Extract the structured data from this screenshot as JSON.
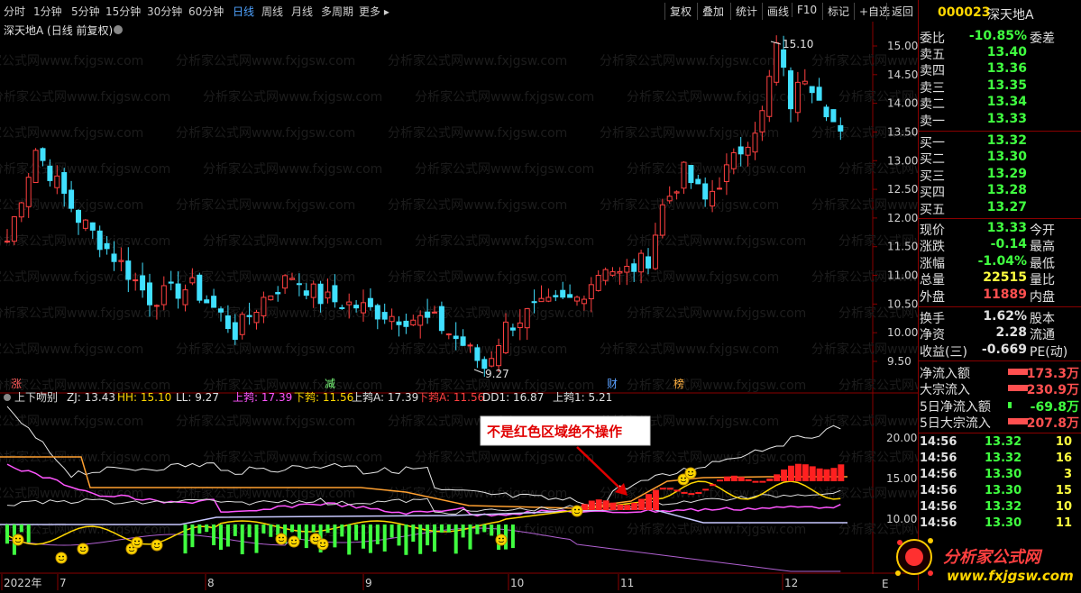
{
  "toolbar": {
    "periods": [
      "分时",
      "1分钟",
      "5分钟",
      "15分钟",
      "30分钟",
      "60分钟",
      "日线",
      "周线",
      "月线",
      "多周期",
      "更多 ▸"
    ],
    "active": "日线",
    "actions": [
      "复权",
      "叠加",
      "统计",
      "画线",
      "F10",
      "标记",
      "+自选",
      "返回"
    ]
  },
  "chart": {
    "title": "深天地A (日线 前复权)",
    "high_label": "15.10",
    "low_label": "9.27",
    "price_axis": [
      "15.00",
      "14.50",
      "14.00",
      "13.50",
      "13.00",
      "12.50",
      "12.00",
      "11.50",
      "11.00",
      "10.50",
      "10.00",
      "9.50"
    ],
    "markers": [
      {
        "text": "涨",
        "color": "#ff5a5a"
      },
      {
        "text": "减",
        "color": "#7cff7c"
      },
      {
        "text": "财",
        "color": "#5aa0ff"
      },
      {
        "text": "榜",
        "color": "#ffb040"
      }
    ],
    "watermark": "分析家公式网www.fxjgsw.com"
  },
  "indicator": {
    "name": "上下吻别",
    "params": [
      {
        "label": "ZJ: 13.43",
        "color": "#e0e0e0"
      },
      {
        "label": "HH: 15.10",
        "color": "#ffd700"
      },
      {
        "label": "LL: 9.27",
        "color": "#e0e0e0"
      },
      {
        "label": "上鹁: 17.39",
        "color": "#ff55ff"
      },
      {
        "label": "下鹁: 11.56",
        "color": "#ffd700"
      },
      {
        "label": "上鹁A: 17.39",
        "color": "#e0e0e0"
      },
      {
        "label": "下鹁A: 11.56",
        "color": "#ff4040"
      },
      {
        "label": "DD1: 16.87",
        "color": "#e0e0e0"
      },
      {
        "label": "上鹁1: 5.21",
        "color": "#e0e0e0"
      }
    ],
    "annotation": "不是红色区域绝不操作",
    "axis": [
      "20.00",
      "15.00",
      "10.00"
    ]
  },
  "date_axis": [
    "2022年",
    "7",
    "8",
    "9",
    "10",
    "11",
    "12"
  ],
  "stock": {
    "code": "000023",
    "name": "深天地A"
  },
  "quote": {
    "weibi": {
      "label": "委比",
      "value": "-10.85%",
      "extra": "委差"
    },
    "asks": [
      {
        "label": "卖五",
        "price": "13.40"
      },
      {
        "label": "卖四",
        "price": "13.36"
      },
      {
        "label": "卖三",
        "price": "13.35"
      },
      {
        "label": "卖二",
        "price": "13.34"
      },
      {
        "label": "卖一",
        "price": "13.33"
      }
    ],
    "bids": [
      {
        "label": "买一",
        "price": "13.32"
      },
      {
        "label": "买二",
        "price": "13.30"
      },
      {
        "label": "买三",
        "price": "13.29"
      },
      {
        "label": "买四",
        "price": "13.28"
      },
      {
        "label": "买五",
        "price": "13.27"
      }
    ],
    "stats": [
      {
        "l": "现价",
        "v": "13.33",
        "c": "#40ff40",
        "r": "今开"
      },
      {
        "l": "涨跌",
        "v": "-0.14",
        "c": "#40ff40",
        "r": "最高"
      },
      {
        "l": "涨幅",
        "v": "-1.04%",
        "c": "#40ff40",
        "r": "最低"
      },
      {
        "l": "总量",
        "v": "22515",
        "c": "#ffff40",
        "r": "量比"
      },
      {
        "l": "外盘",
        "v": "11889",
        "c": "#ff5050",
        "r": "内盘"
      }
    ],
    "stats2": [
      {
        "l": "换手",
        "v": "1.62%",
        "c": "#e0e0e0",
        "r": "股本"
      },
      {
        "l": "净资",
        "v": "2.28",
        "c": "#e0e0e0",
        "r": "流通"
      },
      {
        "l": "收益(三)",
        "v": "-0.669",
        "c": "#e0e0e0",
        "r": "PE(动)"
      }
    ],
    "flows": [
      {
        "l": "净流入额",
        "v": "173.3万",
        "bar": "#ff5050",
        "c": "#ff5050"
      },
      {
        "l": "大宗流入",
        "v": "230.9万",
        "bar": "#ff5050",
        "c": "#ff5050"
      },
      {
        "l": "5日净流入额",
        "v": "-69.8万",
        "bar": "#40ff40",
        "c": "#40ff40"
      },
      {
        "l": "5日大宗流入",
        "v": "207.8万",
        "bar": "#ff5050",
        "c": "#ff5050"
      }
    ],
    "ticks": [
      {
        "t": "14:56",
        "p": "13.32",
        "pc": "#40ff40",
        "v": "10",
        "vc": "#ffff40"
      },
      {
        "t": "14:56",
        "p": "13.32",
        "pc": "#40ff40",
        "v": "16",
        "vc": "#ffff40"
      },
      {
        "t": "14:56",
        "p": "13.30",
        "pc": "#40ff40",
        "v": "3",
        "vc": "#ffff40"
      },
      {
        "t": "14:56",
        "p": "13.30",
        "pc": "#40ff40",
        "v": "15",
        "vc": "#ffff40"
      },
      {
        "t": "14:56",
        "p": "13.32",
        "pc": "#40ff40",
        "v": "10",
        "vc": "#ffff40"
      },
      {
        "t": "14:56",
        "p": "13.30",
        "pc": "#40ff40",
        "v": "11",
        "vc": "#ffff40"
      }
    ]
  },
  "logo": {
    "title": "分析家公式网",
    "url": "www.fxjgsw.com"
  }
}
